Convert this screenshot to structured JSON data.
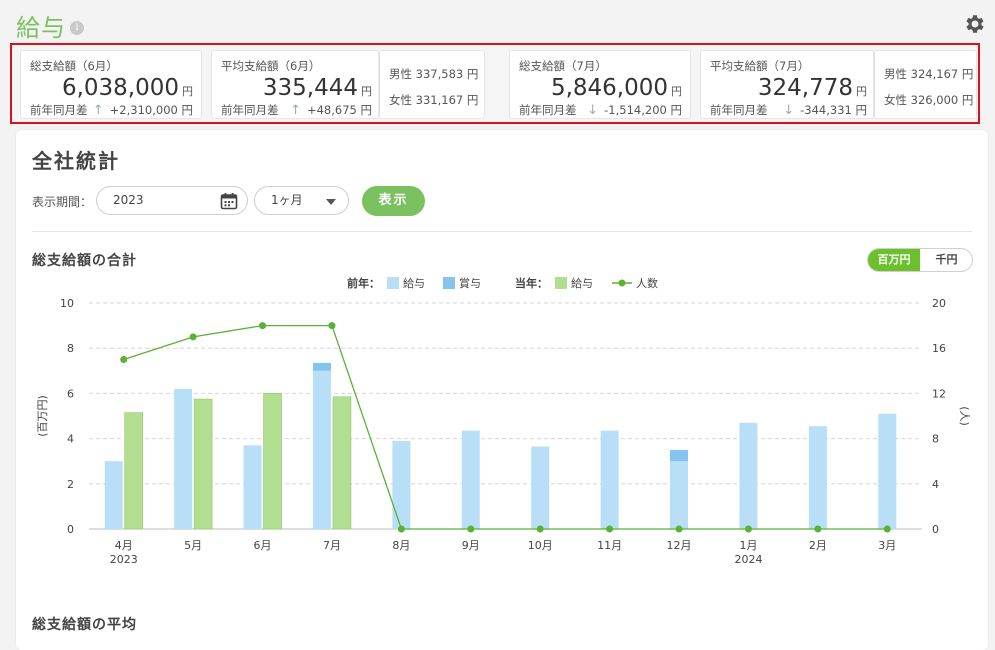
{
  "header": {
    "title": "給与",
    "info_icon": "info-icon",
    "settings_icon": "gear-icon"
  },
  "kpis": [
    {
      "label": "総支給額（6月）",
      "value": "6,038,000",
      "unit": "円",
      "diff_label": "前年同月差",
      "diff_dir": "up",
      "diff": "+2,310,000 円"
    },
    {
      "label": "平均支給額（6月）",
      "value": "335,444",
      "unit": "円",
      "diff_label": "前年同月差",
      "diff_dir": "up",
      "diff": "+48,675 円",
      "male": "男性 337,583 円",
      "female": "女性 331,167 円"
    },
    {
      "label": "総支給額（7月）",
      "value": "5,846,000",
      "unit": "円",
      "diff_label": "前年同月差",
      "diff_dir": "down",
      "diff": "-1,514,200 円"
    },
    {
      "label": "平均支給額（7月）",
      "value": "324,778",
      "unit": "円",
      "diff_label": "前年同月差",
      "diff_dir": "down",
      "diff": "-344,331 円",
      "male": "男性 324,167 円",
      "female": "女性 326,000 円"
    }
  ],
  "section": {
    "title": "全社統計",
    "period_label": "表示期間：",
    "year_value": "2023",
    "range_value": "1ヶ月",
    "show_label": "表示"
  },
  "chart": {
    "title": "総支給額の合計",
    "unit_options": [
      "百万円",
      "千円"
    ],
    "unit_selected": "百万円",
    "next_title": "総支給額の平均"
  },
  "chart_data": {
    "type": "bar",
    "categories": [
      "4月",
      "5月",
      "6月",
      "7月",
      "8月",
      "9月",
      "10月",
      "11月",
      "12月",
      "1月",
      "2月",
      "3月"
    ],
    "year_labels": {
      "0": "2023",
      "9": "2024"
    },
    "legend": {
      "prev_label": "前年：",
      "curr_label": "当年：",
      "salary": "給与",
      "bonus": "賞与",
      "people": "人数"
    },
    "series": [
      {
        "name": "前年 給与",
        "values": [
          3.0,
          6.2,
          3.7,
          7.0,
          3.9,
          4.35,
          3.65,
          4.35,
          3.0,
          4.7,
          4.55,
          5.1
        ],
        "color": "#b8dff7"
      },
      {
        "name": "前年 賞与",
        "values": [
          0,
          0,
          0,
          0.35,
          0,
          0,
          0,
          0,
          0.5,
          0,
          0,
          0
        ],
        "color": "#84c4ef"
      },
      {
        "name": "当年 給与",
        "values": [
          5.15,
          5.75,
          6.0,
          5.85,
          null,
          null,
          null,
          null,
          null,
          null,
          null,
          null
        ],
        "color": "#b1de90"
      },
      {
        "name": "人数",
        "values": [
          15,
          17,
          18,
          18,
          0,
          0,
          0,
          0,
          0,
          0,
          0,
          0
        ],
        "color": "#5ab135"
      }
    ],
    "ylabel": "(百万円)",
    "ylabel_right": "(人)",
    "ylim": [
      0,
      10
    ],
    "y_ticks": [
      0,
      2,
      4,
      6,
      8,
      10
    ],
    "ylim_right": [
      0,
      20
    ],
    "y_ticks_right": [
      0,
      4,
      8,
      12,
      16,
      20
    ],
    "grid": true
  }
}
